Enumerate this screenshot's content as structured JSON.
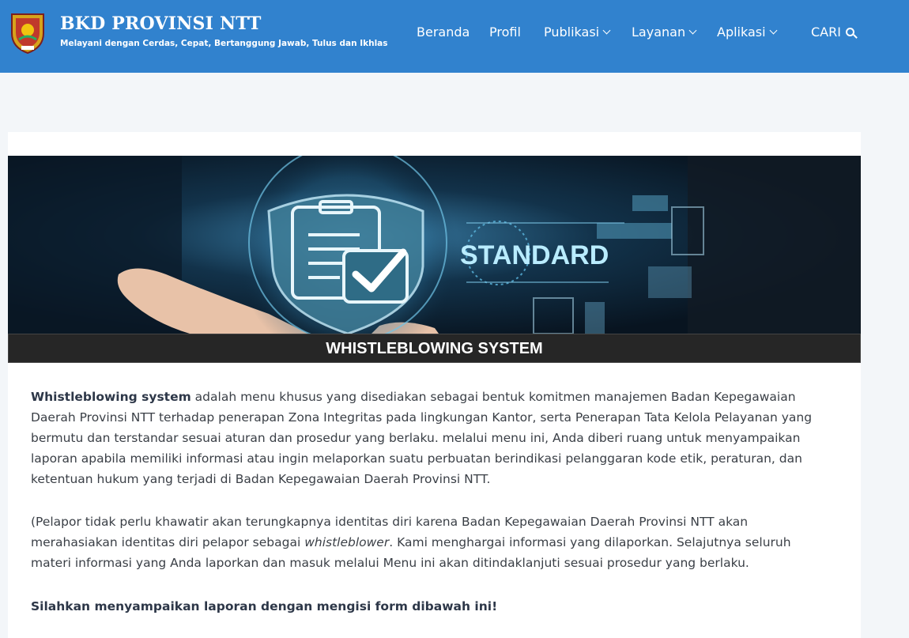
{
  "header": {
    "brand": "BKD PROVINSI NTT",
    "tagline": "Melayani dengan Cerdas, Cepat, Bertanggung Jawab, Tulus dan Ikhlas",
    "logo_icon": "provincial-crest-icon",
    "nav": [
      {
        "label": "Beranda"
      },
      {
        "label": "Profil"
      },
      {
        "label": "Publikasi",
        "icon": "chevron-down-icon"
      },
      {
        "label": "Layanan",
        "icon": "chevron-down-icon"
      },
      {
        "label": "Aplikasi",
        "icon": "chevron-down-icon"
      }
    ],
    "search_label": "CARI",
    "search_icon": "search-icon"
  },
  "banner": {
    "badge_text": "STANDARD"
  },
  "page_title": "WHISTLEBLOWING SYSTEM",
  "content": {
    "p1_lead": "Whistleblowing system",
    "p1_rest": " adalah menu khusus yang disediakan sebagai bentuk komitmen manajemen Badan Kepegawaian Daerah Provinsi NTT terhadap penerapan Zona Integritas pada lingkungan Kantor, serta Penerapan Tata Kelola Pelayanan yang bermutu dan terstandar sesuai aturan dan prosedur yang berlaku. melalui menu ini, Anda diberi ruang untuk menyampaikan laporan apabila memiliki informasi atau ingin melaporkan suatu perbuatan berindikasi pelanggaran kode etik, peraturan, dan ketentuan hukum yang terjadi di Badan Kepegawaian Daerah Provinsi NTT.",
    "p2_a": "(Pelapor tidak perlu khawatir akan terungkapnya identitas diri karena Badan Kepegawaian Daerah Provinsi NTT akan merahasiakan identitas diri pelapor sebagai ",
    "p2_em": "whistleblower",
    "p2_b": ". Kami menghargai informasi yang dilaporkan. Selajutnya seluruh materi informasi yang Anda laporkan dan masuk melalui Menu ini akan ditindaklanjuti sesuai prosedur yang berlaku.",
    "p3": "Silahkan menyampaikan laporan dengan mengisi form dibawah ini!"
  },
  "colors": {
    "header_bg": "#3182ce",
    "title_bar_bg": "#262626",
    "page_bg": "#f3f6f9"
  }
}
